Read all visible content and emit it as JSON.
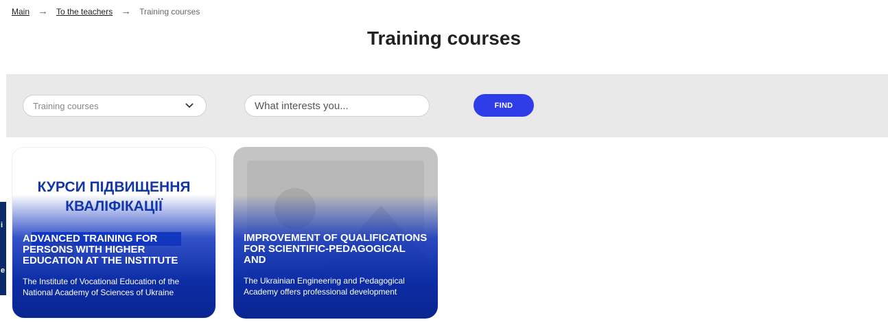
{
  "breadcrumb": {
    "items": [
      "Main",
      "To the teachers"
    ],
    "current": "Training courses",
    "separator": "→"
  },
  "page": {
    "title": "Training courses"
  },
  "filters": {
    "category_value": "Training courses",
    "search_placeholder": "What interests you...",
    "find_label": "FIND"
  },
  "side_tab": {
    "letters": [
      "i",
      "e"
    ]
  },
  "cards": [
    {
      "image_text": "КУРСИ ПІДВИЩЕННЯ КВАЛІФІКАЦІЇ",
      "title": "ADVANCED TRAINING FOR PERSONS WITH HIGHER EDUCATION AT THE INSTITUTE",
      "description": "The Institute of Vocational Education of the National Academy of Sciences of Ukraine"
    },
    {
      "image_text": "",
      "title": "IMPROVEMENT OF QUALIFICATIONS FOR SCIENTIFIC-PEDAGOGICAL AND",
      "description": "The Ukrainian Engineering and Pedagogical Academy offers professional development"
    }
  ],
  "colors": {
    "accent": "#2f3de8",
    "card_overlay": "#0d2da6",
    "filter_bg": "#e9e9e9"
  }
}
